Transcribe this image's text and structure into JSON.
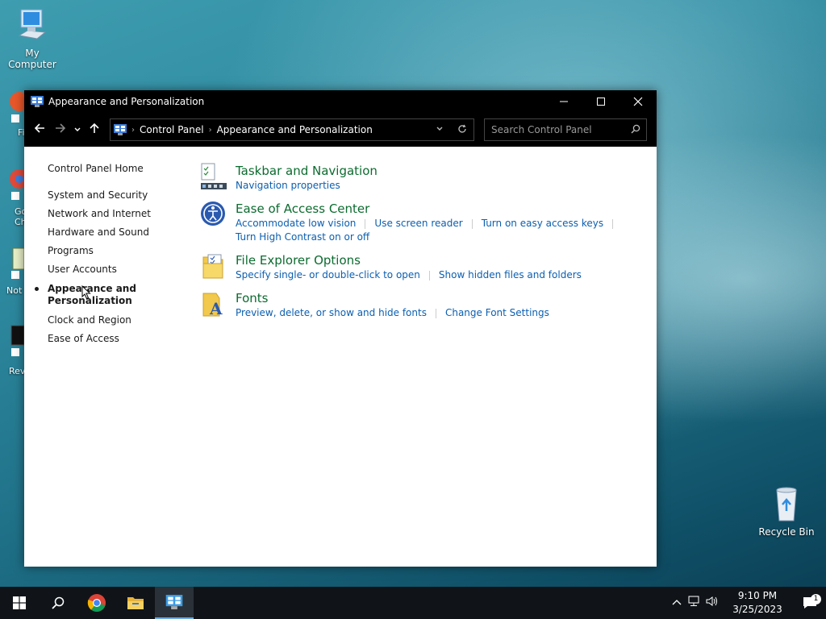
{
  "desktop": {
    "my_computer_label": "My Computer",
    "recycle_bin_label": "Recycle Bin",
    "partial_labels": [
      "Fi",
      "Go\nCh",
      "Not",
      "Rev"
    ]
  },
  "window": {
    "title": "Appearance and Personalization",
    "controls": {
      "minimize": "—",
      "maximize": "☐",
      "close": "✕"
    },
    "address": {
      "crumbs": [
        "Control Panel",
        "Appearance and Personalization"
      ]
    },
    "search": {
      "placeholder": "Search Control Panel"
    },
    "left_nav": {
      "home": "Control Panel Home",
      "items": [
        "System and Security",
        "Network and Internet",
        "Hardware and Sound",
        "Programs",
        "User Accounts",
        "Appearance and Personalization",
        "Clock and Region",
        "Ease of Access"
      ]
    },
    "categories": [
      {
        "title": "Taskbar and Navigation",
        "links": [
          "Navigation properties"
        ]
      },
      {
        "title": "Ease of Access Center",
        "links": [
          "Accommodate low vision",
          "Use screen reader",
          "Turn on easy access keys",
          "Turn High Contrast on or off"
        ]
      },
      {
        "title": "File Explorer Options",
        "links": [
          "Specify single- or double-click to open",
          "Show hidden files and folders"
        ]
      },
      {
        "title": "Fonts",
        "links": [
          "Preview, delete, or show and hide fonts",
          "Change Font Settings"
        ]
      }
    ]
  },
  "taskbar": {
    "time": "9:10 PM",
    "date": "3/25/2023",
    "notification_count": "1"
  },
  "colors": {
    "category_title": "#0c6b2f",
    "link": "#0b5fb0",
    "titlebar": "#000000",
    "taskbar": "#101418"
  }
}
